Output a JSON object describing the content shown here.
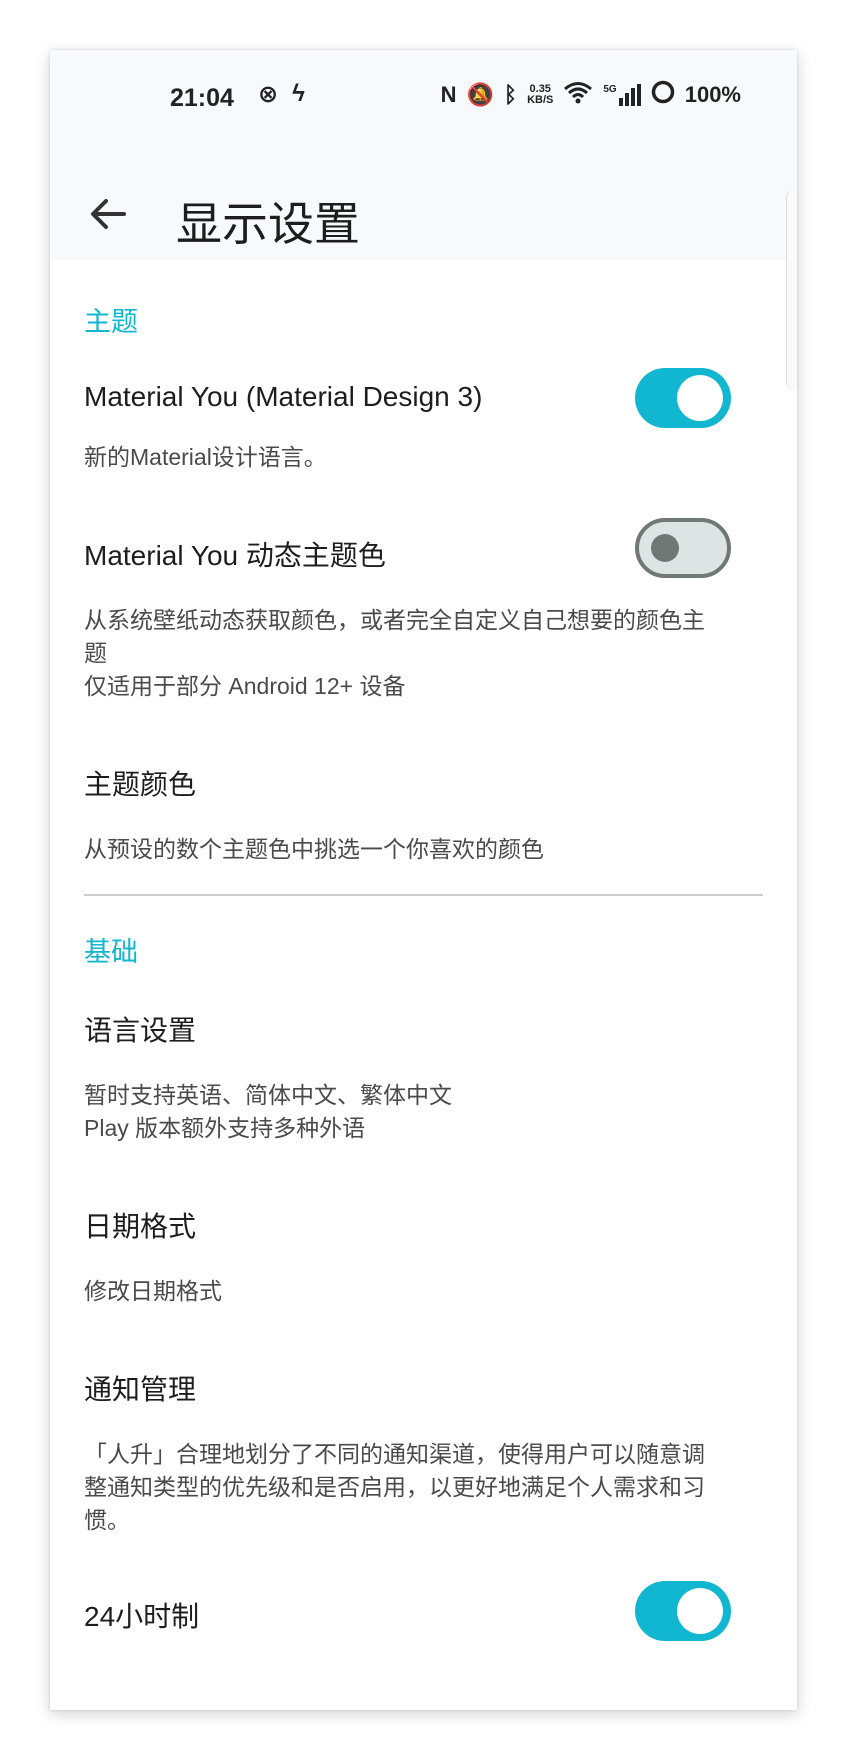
{
  "status_bar": {
    "time": "21:04",
    "speed_value": "0.35",
    "speed_unit": "KB/S",
    "network": "5G",
    "battery": "100%"
  },
  "toolbar": {
    "title": "显示设置"
  },
  "sections": {
    "theme": {
      "title": "主题",
      "material_you": {
        "label": "Material You (Material Design 3)",
        "desc": "新的Material设计语言。",
        "enabled": true
      },
      "dynamic_color": {
        "label": "Material You 动态主题色",
        "desc": "从系统壁纸动态获取颜色，或者完全自定义自己想要的颜色主\n题\n仅适用于部分 Android 12+ 设备",
        "enabled": false
      },
      "theme_color": {
        "label": "主题颜色",
        "desc": "从预设的数个主题色中挑选一个你喜欢的颜色"
      }
    },
    "basic": {
      "title": "基础",
      "language": {
        "label": "语言设置",
        "desc": "暂时支持英语、简体中文、繁体中文\nPlay 版本额外支持多种外语"
      },
      "date_format": {
        "label": "日期格式",
        "desc": "修改日期格式"
      },
      "notifications": {
        "label": "通知管理",
        "desc": "「人升」合理地划分了不同的通知渠道，使得用户可以随意调\n整通知类型的优先级和是否启用，以更好地满足个人需求和习\n惯。"
      },
      "hour24": {
        "label": "24小时制",
        "enabled": true
      }
    }
  },
  "colors": {
    "accent": "#11b6d0",
    "toggle_off_track": "#dde4e3",
    "toggle_off_border": "#707876"
  }
}
